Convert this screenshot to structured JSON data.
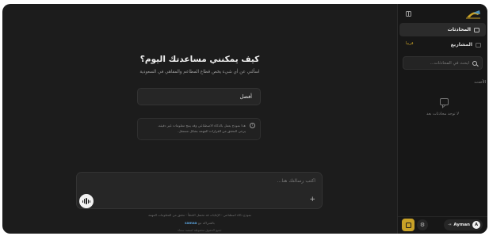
{
  "main": {
    "title": "كيف يمكنني مساعدتك اليوم؟",
    "subtitle": "اسألني عن أي شيء يخص قطاع المطاعم والمقاهي في السعودية",
    "suggestion": "أفضل",
    "notice_line1": "هذا نموذج يعمل بالذكاء الاصطناعي وقد ينتج معلومات غير دقيقة.",
    "notice_line2": "يرجى التحقق من القرارات المهمة بشكل مستقل.",
    "composer_placeholder": "اكتب رسالتك هنا...",
    "footer_disclaimer": "نموذج ذكاء اصطناعي - الإجابات قد تحتمل الخطأ - تحقق من المعلومات المهمة",
    "footer_powered_prefix": "بالشراكة مع",
    "footer_brand": "samaa",
    "footer_copyright": "جميع الحقوق محفوظة لمنصة سماء"
  },
  "sidebar": {
    "nav_conversations": "المحادثات",
    "nav_projects": "المشاريع",
    "soon_badge": "قريبا",
    "search_placeholder": "ابحث في المحادثات...",
    "section_title": "الأحدث",
    "empty_text": "لا توجد محادثات بعد",
    "user_name": "Ayman",
    "user_initial": "A"
  },
  "colors": {
    "accent": "#c9a227",
    "background": "#1c1c1c",
    "sidebar": "#171717",
    "link": "#5aa0d8"
  },
  "icons": [
    "logo-icon",
    "collapse-sidebar-icon",
    "chat-icon",
    "folder-icon",
    "search-icon",
    "info-icon",
    "plus-icon",
    "voice-icon",
    "empty-chat-icon",
    "logout-icon",
    "gear-icon",
    "new-chat-icon"
  ]
}
